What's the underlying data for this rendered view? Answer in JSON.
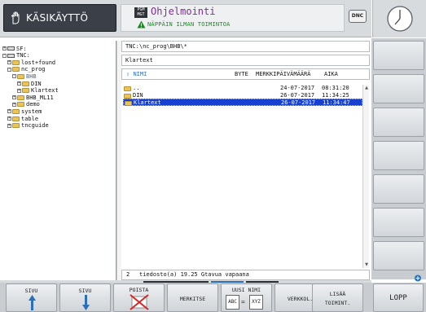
{
  "header": {
    "mode_label": "KÄSIKÄYTTÖ",
    "program_icon_text": "PGM MGT",
    "program_title": "Ohjelmointi",
    "warning_text": "NÄPPÄIN ILMAN TOIMINTOA",
    "dnc_label": "DNC"
  },
  "tree": {
    "items": [
      {
        "label": "SF:",
        "type": "drive",
        "level": 0,
        "expander": "+"
      },
      {
        "label": "TNC:",
        "type": "drive",
        "level": 0,
        "expander": "-"
      },
      {
        "label": "lost+found",
        "type": "folder",
        "level": 1,
        "expander": "+"
      },
      {
        "label": "nc_prog",
        "type": "folder",
        "level": 1,
        "expander": "-"
      },
      {
        "label": "BHB",
        "type": "folder",
        "level": 2,
        "expander": "-",
        "highlight": true
      },
      {
        "label": "DIN",
        "type": "folder",
        "level": 3,
        "expander": "+"
      },
      {
        "label": "Klartext",
        "type": "folder",
        "level": 3,
        "expander": "+"
      },
      {
        "label": "BHB_ML11",
        "type": "folder",
        "level": 2,
        "expander": "+"
      },
      {
        "label": "demo",
        "type": "folder",
        "level": 2,
        "expander": "+"
      },
      {
        "label": "system",
        "type": "folder",
        "level": 1,
        "expander": "+"
      },
      {
        "label": "table",
        "type": "folder",
        "level": 1,
        "expander": "+"
      },
      {
        "label": "tncguide",
        "type": "folder",
        "level": 1,
        "expander": "+"
      }
    ]
  },
  "file_panel": {
    "path": "TNC:\\nc_prog\\BHB\\*",
    "current_name": "Klartext",
    "columns": {
      "name": "NIMI",
      "bytes": "BYTE",
      "date": "MERKKIPÄIVÄMÄÄRÄ",
      "time": "AIKA"
    },
    "name_sort_icon": "sort-up-icon",
    "rows": [
      {
        "name": "..",
        "date": "24-07-2017",
        "time": "08:31:20",
        "selected": false
      },
      {
        "name": "DIN",
        "date": "26-07-2017",
        "time": "11:34:25",
        "selected": false
      },
      {
        "name": "Klartext",
        "date": "26-07-2017",
        "time": "11:34:47",
        "selected": true
      }
    ],
    "status_count": "2",
    "status_text": "tiedosto(a)  19.25 Gtavua vapaana"
  },
  "softkeys": {
    "page_up": "SIVU",
    "page_down": "SIVU",
    "delete": "POISTA",
    "mark": "MERKITSE",
    "rename_top": "UUSI NIMI",
    "rename_from": "ABC",
    "rename_to": "XYZ",
    "network": "VERKKOL.",
    "more_top": "LISÄÄ",
    "more_bottom": "TOIMINT.",
    "end": "LOPP"
  },
  "colors": {
    "selection": "#1740d0",
    "accent_blue": "#2a6fb8",
    "title_purple": "#7d2f96",
    "warning_green": "#21842b",
    "folder_yellow": "#e8c45a"
  }
}
